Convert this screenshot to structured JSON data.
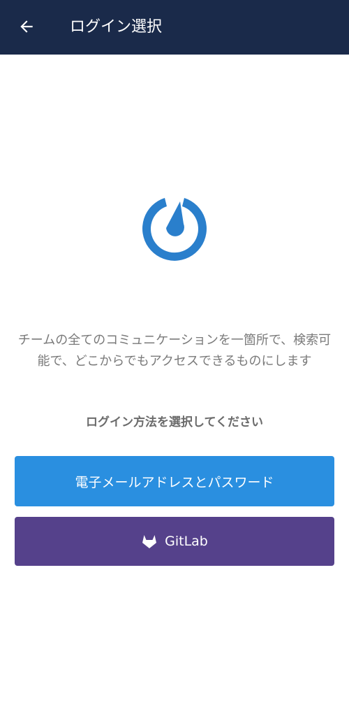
{
  "header": {
    "title": "ログイン選択",
    "back_icon": "arrow-left-icon",
    "background_color": "#1a2a4a"
  },
  "logo": {
    "icon": "mattermost-logo-icon",
    "color": "#2a7fcc"
  },
  "tagline": "チームの全てのコミュニケーションを一箇所で、検索可能で、どこからでもアクセスできるものにします",
  "select_prompt": "ログイン方法を選択してください",
  "buttons": {
    "email_password": {
      "label": "電子メールアドレスとパスワード",
      "color": "#2a8fe0"
    },
    "gitlab": {
      "label": "GitLab",
      "icon": "gitlab-icon",
      "color": "#55418b"
    }
  }
}
